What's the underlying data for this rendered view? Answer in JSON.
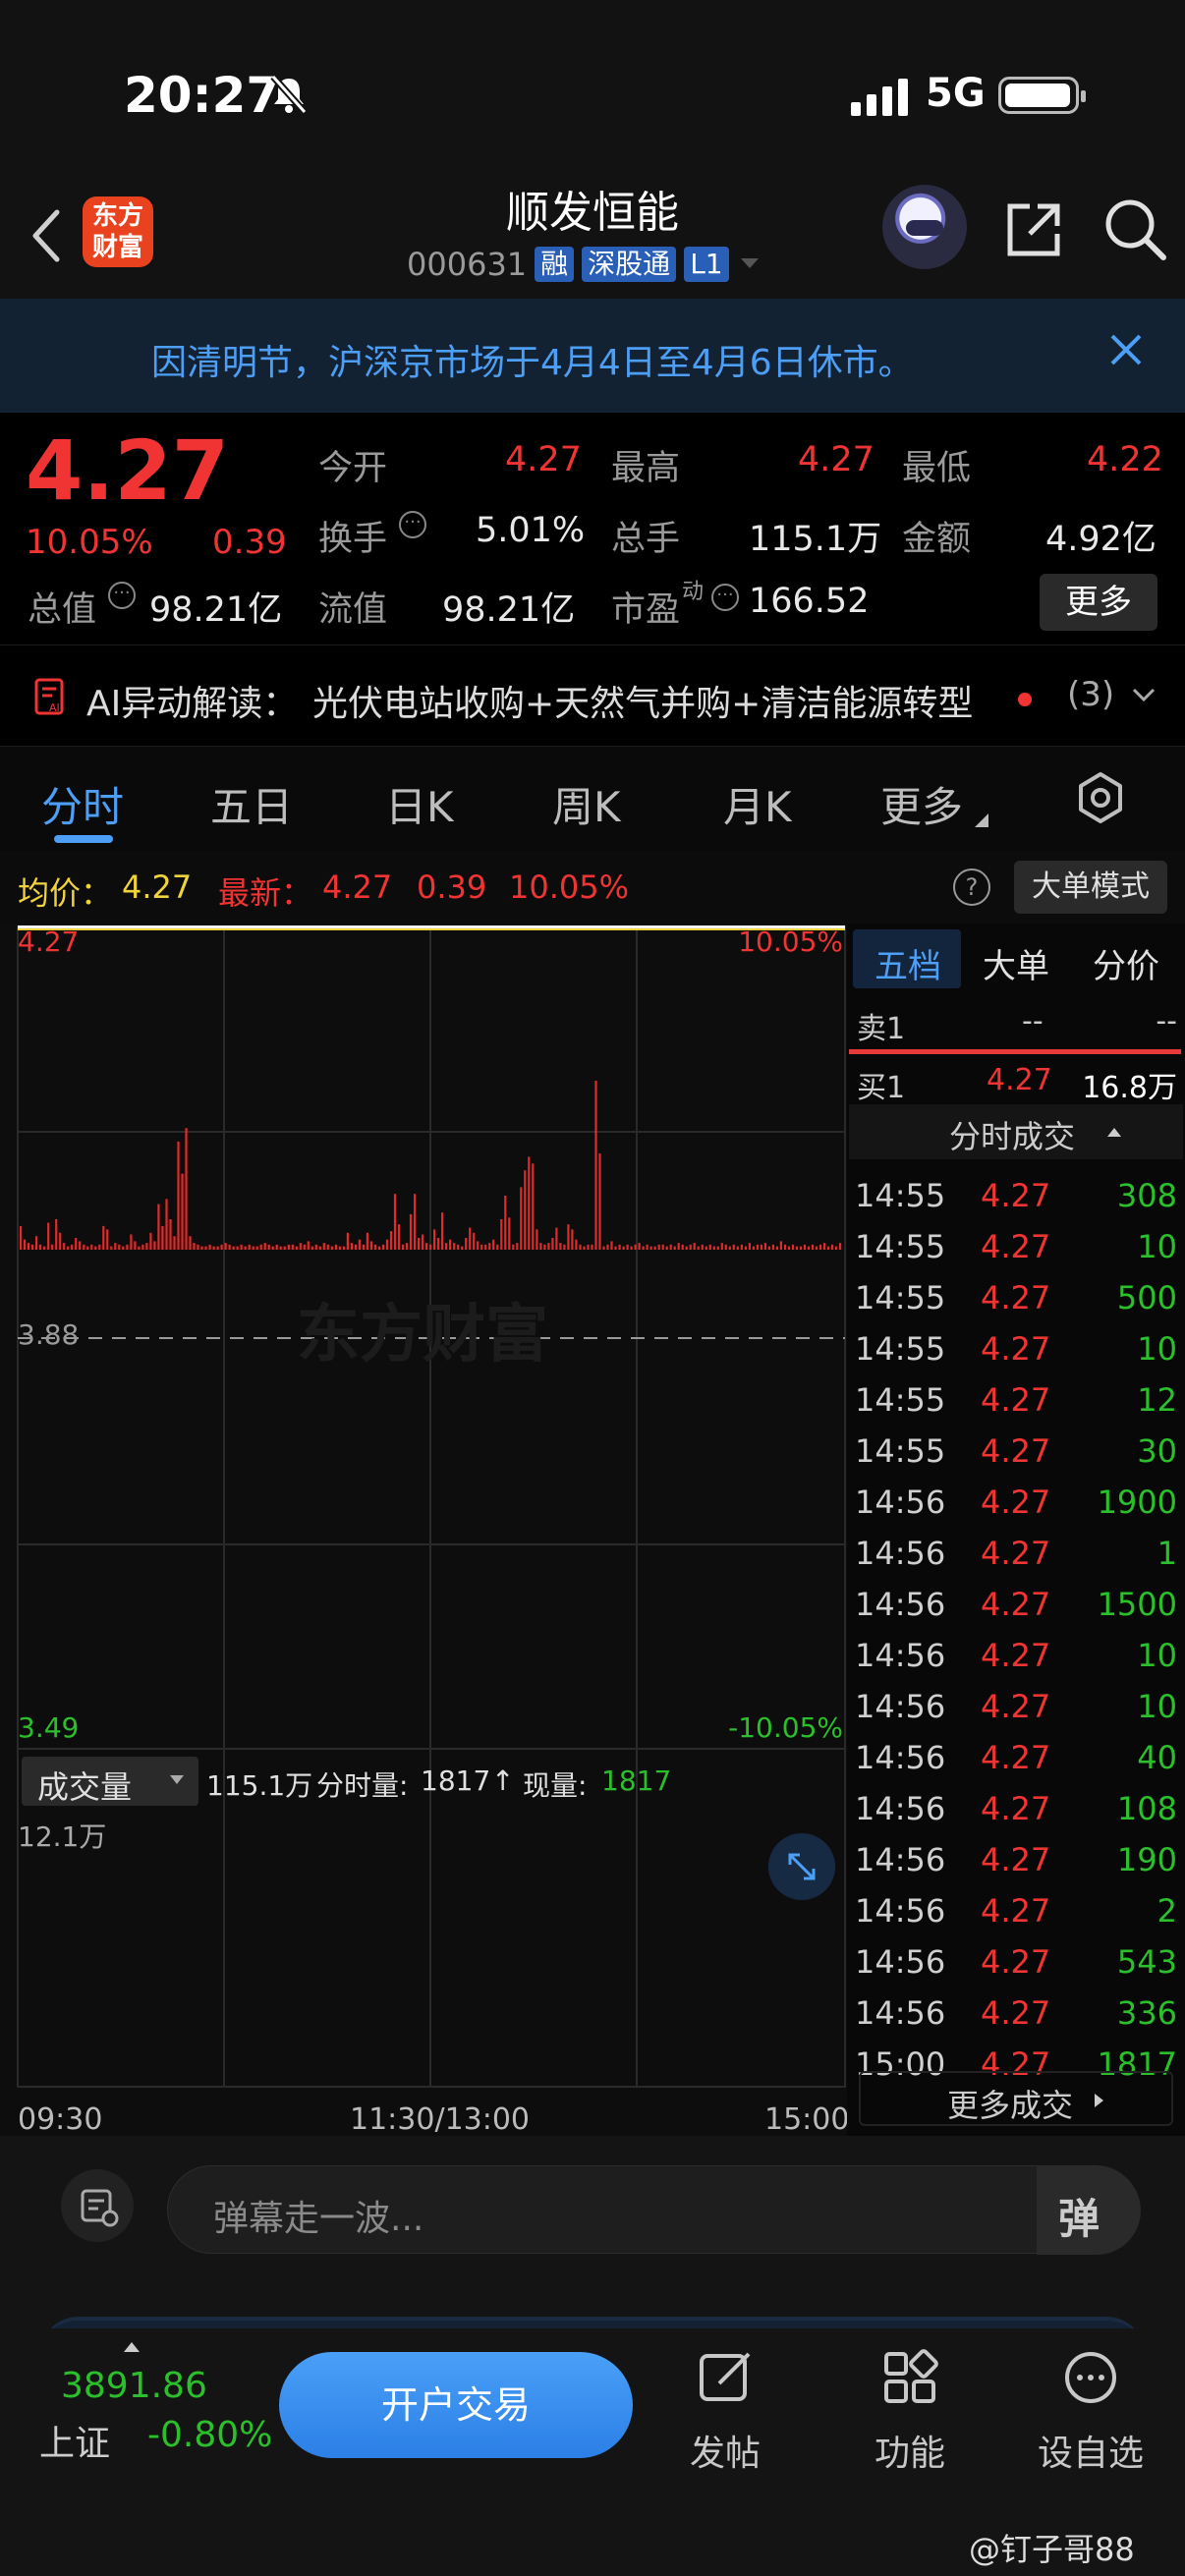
{
  "status": {
    "time": "20:27",
    "network": "5G"
  },
  "header": {
    "logo_line1": "东方",
    "logo_line2": "财富",
    "title": "顺发恒能",
    "code": "000631",
    "badges": [
      "融",
      "深股通",
      "L1"
    ]
  },
  "notice": {
    "text": "因清明节，沪深京市场于4月4日至4月6日休市。"
  },
  "quote": {
    "price": "4.27",
    "pct": "10.05%",
    "change": "0.39",
    "open_label": "今开",
    "open": "4.27",
    "high_label": "最高",
    "high": "4.27",
    "low_label": "最低",
    "low": "4.22",
    "turnover_label": "换手",
    "turnover": "5.01%",
    "volume_label": "总手",
    "volume": "115.1万",
    "amount_label": "金额",
    "amount": "4.92亿",
    "mktcap_label": "总值",
    "mktcap": "98.21亿",
    "float_label": "流值",
    "float": "98.21亿",
    "pe_label": "市盈",
    "pe_sup": "动",
    "pe": "166.52",
    "more": "更多"
  },
  "ai": {
    "prefix": "AI异动解读：",
    "text": "光伏电站收购+天然气并购+清洁能源转型",
    "count": "(3)"
  },
  "tabs": [
    "分时",
    "五日",
    "日K",
    "周K",
    "月K",
    "更多"
  ],
  "chart": {
    "avg_label": "均价：",
    "avg": "4.27",
    "latest_label": "最新：",
    "latest": "4.27",
    "latest_change": "0.39",
    "latest_pct": "10.05%",
    "mode_button": "大单模式",
    "price_top": "4.27",
    "price_mid": "3.88",
    "price_bottom": "3.49",
    "pct_top": "10.05%",
    "pct_bottom": "-10.05%",
    "watermark": "东方财富",
    "vol_selector": "成交量",
    "vol_total": "115.1万",
    "vol_period_label": "分时量:",
    "vol_period": "1817",
    "vol_now_label": "现量:",
    "vol_now": "1817",
    "vol_max": "12.1万",
    "time_start": "09:30",
    "time_mid": "11:30/13:00",
    "time_end": "15:00"
  },
  "chart_data": {
    "type": "bar",
    "title": "",
    "xlabel": "",
    "ylabel": "",
    "x": [
      "09:30",
      "11:30/13:00",
      "15:00"
    ],
    "ylim": [
      0,
      121000
    ],
    "y_tick_labels": [
      "12.1万"
    ],
    "series": [
      {
        "values": [
          14,
          6,
          4,
          3,
          8,
          3,
          2,
          16,
          3,
          18,
          10,
          4,
          2,
          3,
          7,
          5,
          3,
          2,
          3,
          2,
          3,
          14,
          12,
          2,
          4,
          3,
          2,
          3,
          9,
          5,
          2,
          3,
          4,
          10,
          5,
          27,
          14,
          30,
          18,
          8,
          64,
          45,
          72,
          8,
          4,
          3,
          2,
          2,
          3,
          2,
          2,
          3,
          4,
          3,
          2,
          2,
          3,
          2,
          3,
          2,
          2,
          3,
          4,
          3,
          2,
          3,
          2,
          2,
          3,
          3,
          2,
          4,
          3,
          5,
          2,
          3,
          2,
          4,
          3,
          2,
          3,
          2,
          2,
          10,
          4,
          3,
          6,
          3,
          10,
          5,
          3,
          2,
          3,
          6,
          11,
          33,
          15,
          3,
          4,
          21,
          33,
          7,
          9,
          4,
          3,
          12,
          7,
          22,
          4,
          6,
          4,
          3,
          2,
          7,
          13,
          10,
          5,
          3,
          3,
          4,
          6,
          3,
          18,
          32,
          19,
          3,
          4,
          37,
          47,
          55,
          51,
          12,
          4,
          3,
          4,
          7,
          13,
          4,
          3,
          15,
          12,
          6,
          3,
          2,
          3,
          3,
          100,
          57,
          2,
          3,
          5,
          2,
          3,
          2,
          3,
          2,
          3,
          4,
          2,
          3,
          2,
          2,
          3,
          3,
          2,
          3,
          2,
          4,
          3,
          2,
          3,
          4,
          2,
          3,
          2,
          3,
          2,
          2,
          4,
          3,
          2,
          3,
          2,
          3,
          2,
          4,
          2,
          3,
          3,
          4,
          2,
          3,
          2,
          5,
          3,
          2,
          3,
          2,
          2,
          3,
          2,
          3,
          2,
          3,
          4,
          2,
          3,
          2,
          4
        ]
      }
    ]
  },
  "side": {
    "tabs": [
      "五档",
      "大单",
      "分价"
    ],
    "sell1_label": "卖1",
    "sell1_price": "--",
    "sell1_vol": "--",
    "buy1_label": "买1",
    "buy1_price": "4.27",
    "buy1_vol": "16.8万",
    "trades_title": "分时成交",
    "trades": [
      {
        "t": "14:55",
        "p": "4.27",
        "v": "308"
      },
      {
        "t": "14:55",
        "p": "4.27",
        "v": "10"
      },
      {
        "t": "14:55",
        "p": "4.27",
        "v": "500"
      },
      {
        "t": "14:55",
        "p": "4.27",
        "v": "10"
      },
      {
        "t": "14:55",
        "p": "4.27",
        "v": "12"
      },
      {
        "t": "14:55",
        "p": "4.27",
        "v": "30"
      },
      {
        "t": "14:56",
        "p": "4.27",
        "v": "1900"
      },
      {
        "t": "14:56",
        "p": "4.27",
        "v": "1"
      },
      {
        "t": "14:56",
        "p": "4.27",
        "v": "1500"
      },
      {
        "t": "14:56",
        "p": "4.27",
        "v": "10"
      },
      {
        "t": "14:56",
        "p": "4.27",
        "v": "10"
      },
      {
        "t": "14:56",
        "p": "4.27",
        "v": "40"
      },
      {
        "t": "14:56",
        "p": "4.27",
        "v": "108"
      },
      {
        "t": "14:56",
        "p": "4.27",
        "v": "190"
      },
      {
        "t": "14:56",
        "p": "4.27",
        "v": "2"
      },
      {
        "t": "14:56",
        "p": "4.27",
        "v": "543"
      },
      {
        "t": "14:56",
        "p": "4.27",
        "v": "336"
      },
      {
        "t": "15:00",
        "p": "4.27",
        "v": "1817"
      }
    ],
    "more_trades": "更多成交"
  },
  "comment": {
    "placeholder": "弹幕走一波...",
    "danmu_button": "弹"
  },
  "bottom": {
    "index_value": "3891.86",
    "index_name": "上证",
    "index_pct": "-0.80%",
    "trade_button": "开户交易",
    "post": "发帖",
    "functions": "功能",
    "watchlist": "设自选"
  },
  "watermark_credit": "@钉子哥88",
  "colors": {
    "up": "#f03434",
    "down": "#2bc02b",
    "accent": "#4d9ef5",
    "bg": "#000000"
  }
}
